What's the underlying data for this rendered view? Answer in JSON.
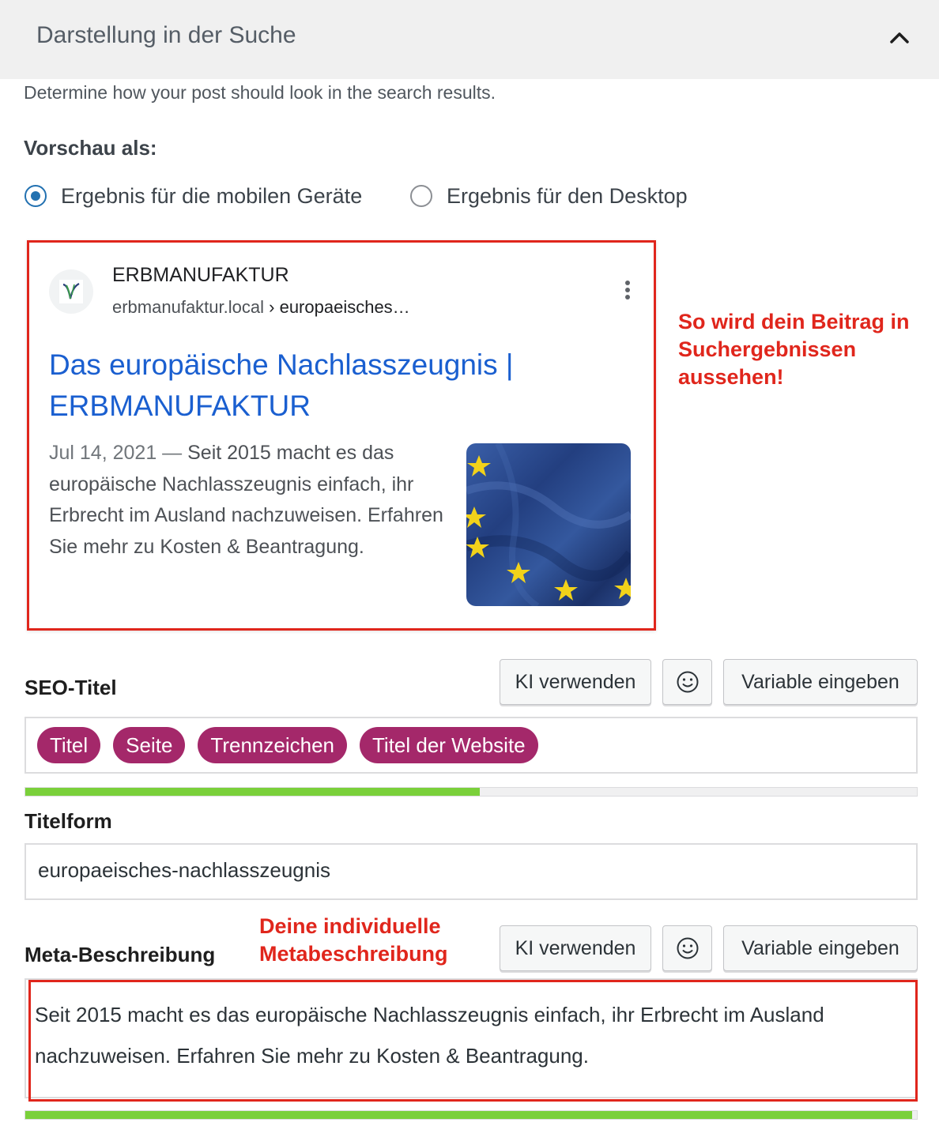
{
  "panel": {
    "title": "Darstellung in der Suche",
    "description": "Determine how your post should look in the search results.",
    "preview_label": "Vorschau als:",
    "collapse_icon": "chevron-up-icon"
  },
  "preview_mode": {
    "options": [
      {
        "label": "Ergebnis für die mobilen Geräte",
        "selected": true
      },
      {
        "label": "Ergebnis für den Desktop",
        "selected": false
      }
    ]
  },
  "snippet": {
    "site_name": "ERBMANUFAKTUR",
    "url_base": "erbmanufaktur.local",
    "url_separator": "›",
    "url_path": "europaeisches…",
    "title": "Das europäische Nachlasszeugnis | ERBMANUFAKTUR",
    "date": "Jul 14, 2021",
    "date_separator": "—",
    "description": "Seit 2015 macht es das europäische Nachlasszeugnis einfach, ihr Erbrecht im Ausland nachzuweisen. Erfahren Sie mehr zu Kosten & Beantragung.",
    "thumbnail_icon": "eu-flag-image",
    "menu_icon": "more-vertical-icon"
  },
  "annotations": {
    "preview_note": "So wird dein Beitrag in Suchergebnissen aussehen!",
    "meta_note": "Deine individuelle Metabeschreibung"
  },
  "seo_title": {
    "label": "SEO-Titel",
    "buttons": {
      "ai": "KI verwenden",
      "emoji_icon": "smiley-icon",
      "variable": "Variable eingeben"
    },
    "tags": [
      "Titel",
      "Seite",
      "Trennzeichen",
      "Titel der Website"
    ],
    "progress": 0.51
  },
  "slug": {
    "label": "Titelform",
    "value": "europaeisches-nachlasszeugnis"
  },
  "meta_description": {
    "label": "Meta-Beschreibung",
    "buttons": {
      "ai": "KI verwenden",
      "emoji_icon": "smiley-icon",
      "variable": "Variable eingeben"
    },
    "value": "Seit 2015 macht es das europäische Nachlasszeugnis einfach, ihr Erbrecht im Ausland nachzuweisen. Erfahren Sie mehr zu Kosten & Beantragung.",
    "progress": 0.995
  },
  "colors": {
    "accent": "#2271b1",
    "link": "#1a5fd0",
    "tag": "#a4286a",
    "progress_good": "#7ad03a",
    "annotation": "#e0261c"
  }
}
